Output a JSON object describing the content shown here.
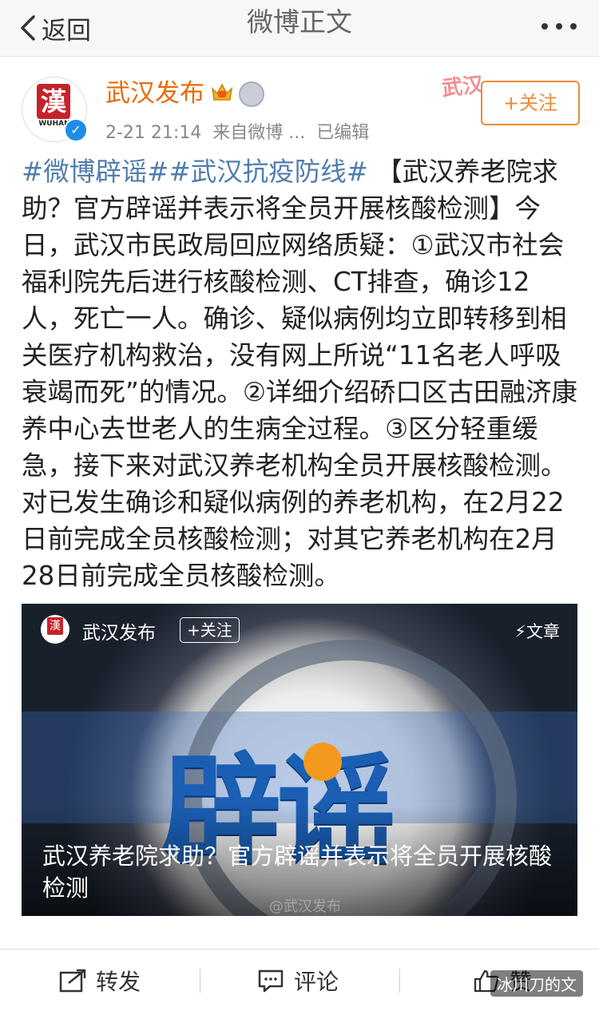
{
  "nav": {
    "back_label": "返回",
    "title": "微博正文"
  },
  "header": {
    "author": "武汉发布",
    "avatar_text": "WUHAN",
    "meta": "2-21 21:14  来自微博 ...  已编辑",
    "stamp": "武汉",
    "follow_label": "+关注"
  },
  "post": {
    "tags": [
      "#微博辟谣#",
      "#武汉抗疫防线#"
    ],
    "text": " 【武汉养老院求助？官方辟谣并表示将全员开展核酸检测】今日，武汉市民政局回应网络质疑：①武汉市社会福利院先后进行核酸检测、CT排查，确诊12人，死亡一人。确诊、疑似病例均立即转移到相关医疗机构救治，没有网上所说“11名老人呼吸衰竭而死”的情况。②详细介绍硚口区古田融济康养中心去世老人的生病全过程。③区分轻重缓急，接下来对武汉养老机构全员开展核酸检测。对已发生确诊和疑似病例的养老机构，在2月22日前完成全员核酸检测；对其它养老机构在2月28日前完成全员核酸检测。"
  },
  "card": {
    "author": "武汉发布",
    "follow_label": "+关注",
    "type_label": "文章",
    "image_text": "辟谣",
    "title": "武汉养老院求助？官方辟谣并表示将全员开展核酸检测",
    "watermark": "@武汉发布"
  },
  "toolbar": {
    "repost": "转发",
    "comment": "评论",
    "like": "赞"
  },
  "overlay": {
    "watermark": "冰川刀的文"
  }
}
